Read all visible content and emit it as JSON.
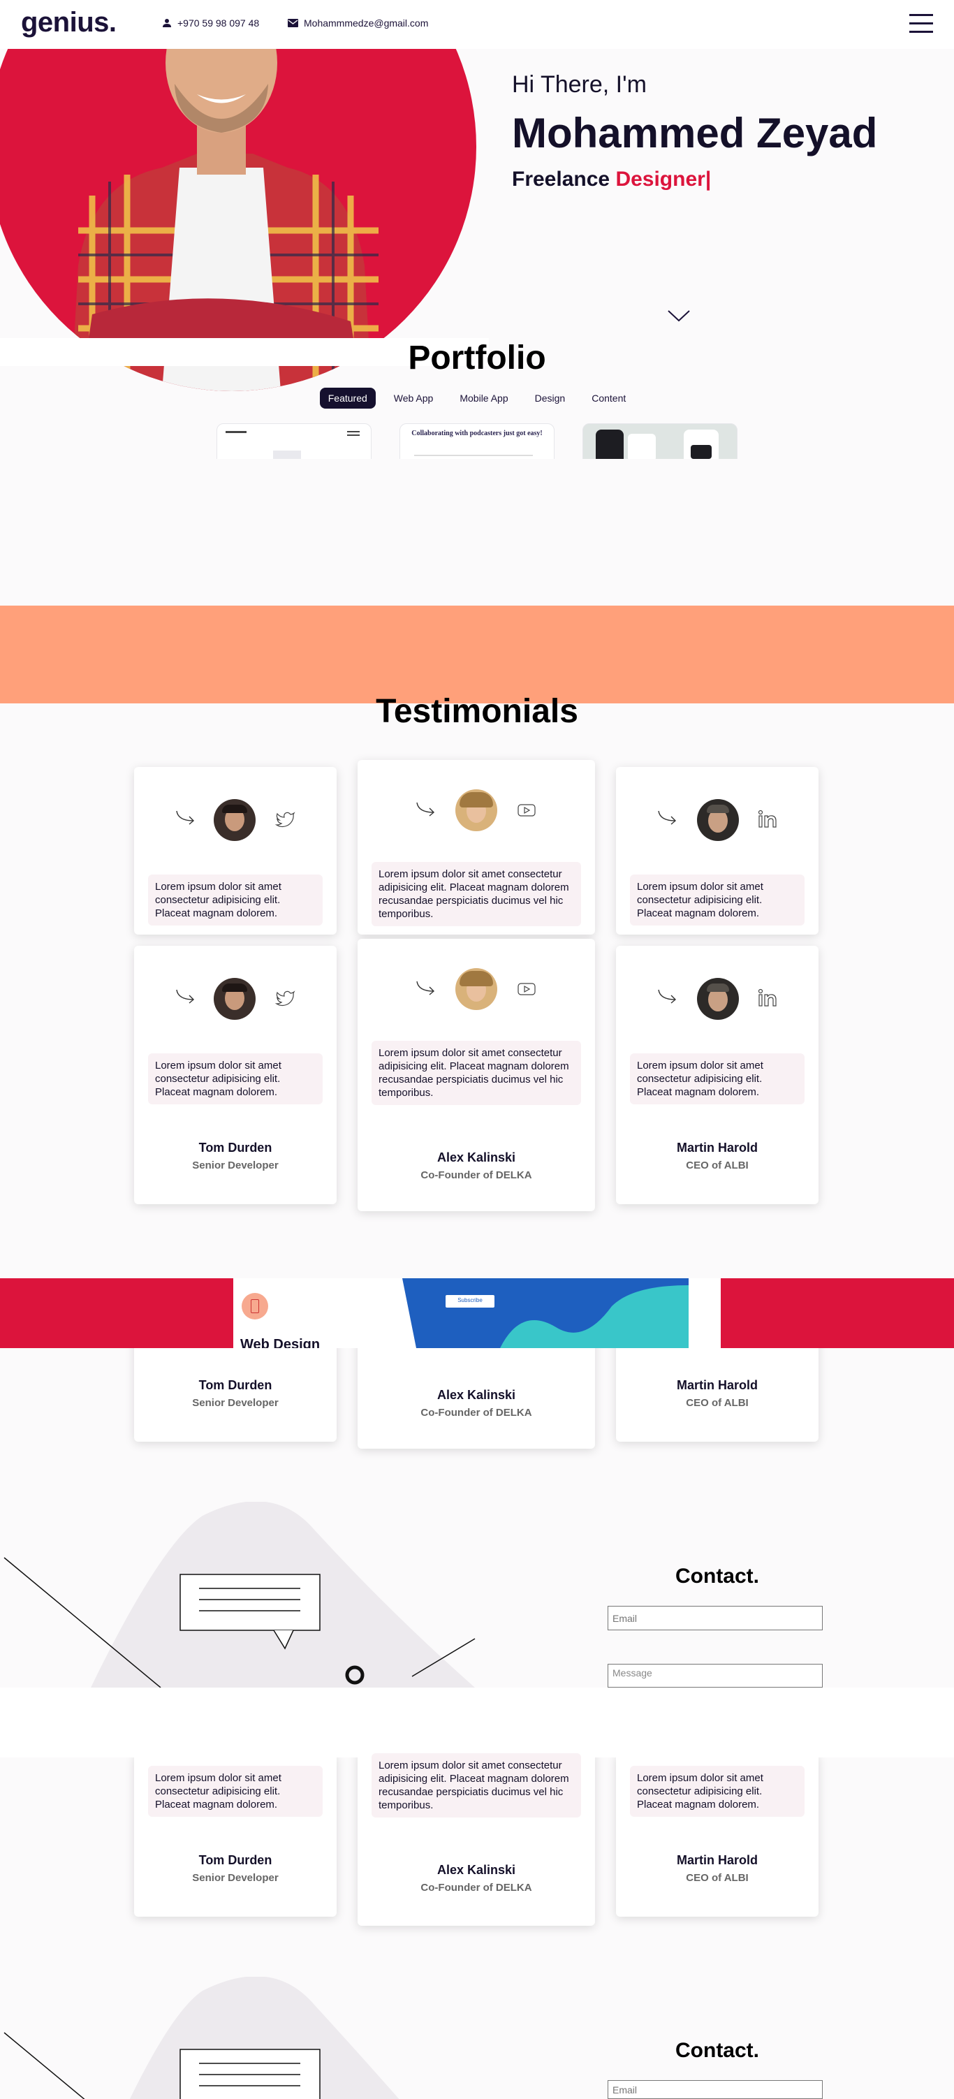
{
  "header": {
    "logo": "genius.",
    "phone": "+970 59 98 097 48",
    "email": "Mohammmedze@gmail.com"
  },
  "hero": {
    "greeting": "Hi There, I'm",
    "name": "Mohammed Zeyad",
    "role_prefix": "Freelance",
    "role_accent": "Designer|"
  },
  "portfolio": {
    "title": "Portfolio",
    "tabs": [
      "Featured",
      "Web App",
      "Mobile App",
      "Design",
      "Content"
    ],
    "active_tab": "Featured",
    "card2_text": "Collaborating with podcasters just got easy!"
  },
  "testimonials": {
    "title": "Testimonials",
    "quote_short": "Lorem ipsum dolor sit amet consectetur adipisicing elit. Placeat magnam dolorem.",
    "quote_long": "Lorem ipsum dolor sit amet consectetur adipisicing elit. Placeat magnam dolorem recusandae perspiciatis ducimus vel hic temporibus.",
    "people": [
      {
        "name": "Tom Durden",
        "role": "Senior Developer",
        "social": "twitter-icon"
      },
      {
        "name": "Alex Kalinski",
        "role": "Co-Founder of DELKA",
        "social": "youtube-icon"
      },
      {
        "name": "Martin Harold",
        "role": "CEO of ALBI",
        "social": "linkedin-icon"
      }
    ]
  },
  "works": {
    "label": "Web Design",
    "preview_button": "Subscribe"
  },
  "contact": {
    "title": "Contact.",
    "email_placeholder": "Email",
    "message_placeholder": "Message"
  },
  "colors": {
    "accent": "#dc143c",
    "dark": "#15102e",
    "orange": "#ffa07a"
  }
}
